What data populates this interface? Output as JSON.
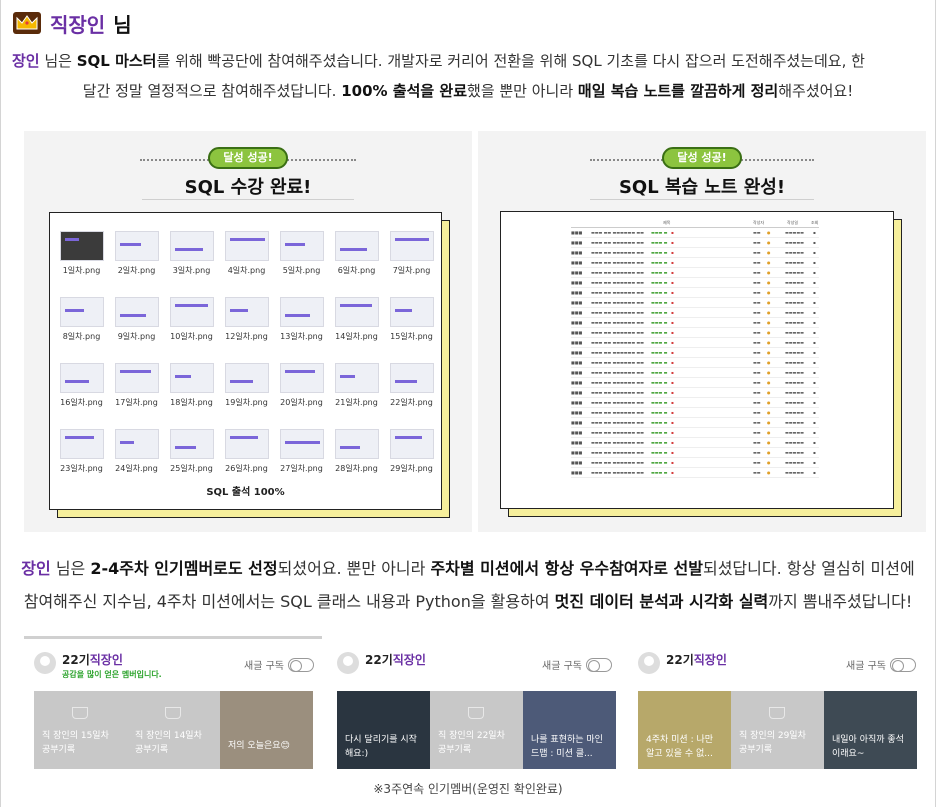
{
  "header": {
    "name": "직장인",
    "suffix": "님"
  },
  "para1": {
    "line1_parts": [
      "장인",
      " 님은 ",
      "SQL 마스터",
      "를 위해 빡공단에 참여해주셨습니다. 개발자로 커리어 전환을 위해 SQL 기초를 다시 잡으러 도전해주셨는데요, 한"
    ],
    "line2_parts": [
      "달간 정말 열정적으로 참여해주셨답니다. ",
      "100% 출석을 완료",
      "했을 뿐만 아니라 ",
      "매일 복습 노트를 깔끔하게 정리",
      "해주셨어요!"
    ]
  },
  "panel_left": {
    "badge": "달성 성공!",
    "title": "SQL 수강 완료!",
    "footer": "SQL 출석 100%",
    "thumbs": [
      "1일차.png",
      "2일차.png",
      "3일차.png",
      "4일차.png",
      "5일차.png",
      "6일차.png",
      "7일차.png",
      "8일차.png",
      "9일차.png",
      "10일차.png",
      "12일차.png",
      "13일차.png",
      "14일차.png",
      "15일차.png",
      "16일차.png",
      "17일차.png",
      "18일차.png",
      "19일차.png",
      "20일차.png",
      "21일차.png",
      "22일차.png",
      "23일차.png",
      "24일차.png",
      "25일차.png",
      "26일차.png",
      "27일차.png",
      "28일차.png",
      "29일차.png"
    ]
  },
  "panel_right": {
    "badge": "달성 성공!",
    "title": "SQL 복습 노트 완성!",
    "table_header": [
      "제목",
      "작성자",
      "작성일",
      "조회"
    ],
    "row_count": 25
  },
  "para2": {
    "line1_parts": [
      "장인",
      " 님은 ",
      "2-4주차 인기멤버로도 선정",
      "되셨어요. 뿐만 아니라 ",
      "주차별 미션에서 항상 우수참여자로 선발",
      "되셨답니다. 항상 열심히 미션에"
    ],
    "line2_parts": [
      "참여해주신 지수님, 4주차 미션에서는 SQL 클래스 내용과 Python을 활용하여 ",
      "멋진 데이터 분석과 시각화 실력",
      "까지 뽐내주셨답니다!"
    ]
  },
  "members": [
    {
      "prefix": "22기",
      "name": "직장인",
      "sub": "공감을 많이 얻은 멤버입니다.",
      "sub_label": "새글 구독",
      "tiles": [
        "직 장인의 15일차 공부기록",
        "직 장인의 14일차 공부기록",
        "저의 오늘은요😊"
      ]
    },
    {
      "prefix": "22기",
      "name": "직장인",
      "sub": "",
      "sub_label": "새글 구독",
      "tiles": [
        "다시 달리기를 시작해요:)",
        "직 장인의 22일차 공부기록",
        "나를 표현하는 마인드맵 : 미션 클..."
      ]
    },
    {
      "prefix": "22기",
      "name": "직장인",
      "sub": "",
      "sub_label": "새글 구독",
      "tiles": [
        "4주차 미션 : 나만 알고 있을 수 없...",
        "직 장인의 29일차 공부기록",
        "내일아 아직까 좋석이래요~"
      ]
    }
  ],
  "footer_note": "※3주연속 인기멤버(운영진 확인완료)",
  "colors": {
    "accent": "#6a2fa4",
    "badge_green": "#8cc43f",
    "note_yellow": "#f6ef9c"
  },
  "icons": {
    "crown": "crown-icon",
    "avatar": "avatar-icon",
    "toggle": "toggle-icon"
  }
}
